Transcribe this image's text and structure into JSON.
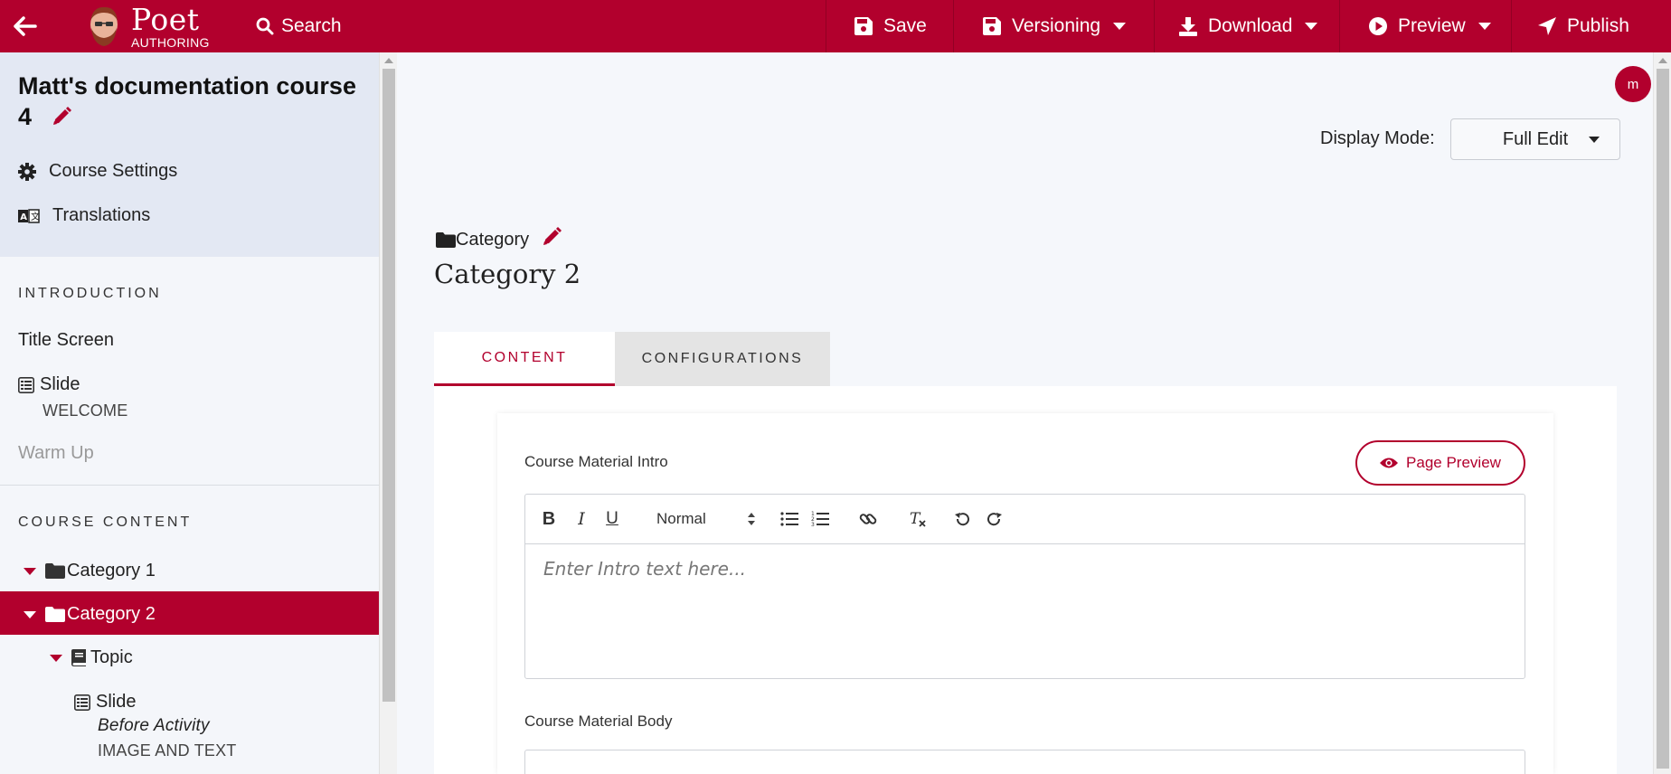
{
  "topbar": {
    "brand_name": "Poet",
    "brand_sub": "AUTHORING",
    "search_label": "Search",
    "save_label": "Save",
    "versioning_label": "Versioning",
    "download_label": "Download",
    "preview_label": "Preview",
    "publish_label": "Publish",
    "bar_color": "#b2002d"
  },
  "sidebar": {
    "course_title": "Matt's documentation course 4",
    "links": [
      {
        "label": "Course Settings",
        "icon": "gear-icon"
      },
      {
        "label": "Translations",
        "icon": "translate-icon"
      }
    ],
    "intro_section_label": "INTRODUCTION",
    "intro_items": {
      "title_screen": "Title Screen",
      "slide_label": "Slide",
      "slide_type": "WELCOME",
      "warm_up": "Warm Up"
    },
    "course_content_label": "COURSE CONTENT",
    "tree": {
      "category1": "Category 1",
      "category2": "Category 2",
      "topic": "Topic",
      "slide_label": "Slide",
      "slide_name": "Before Activity",
      "slide_type": "IMAGE AND TEXT"
    }
  },
  "main": {
    "user_initial": "m",
    "display_mode_label": "Display Mode:",
    "display_mode_value": "Full Edit",
    "breadcrumb_label": "Category",
    "heading": "Category 2",
    "tabs": [
      {
        "label": "CONTENT",
        "active": true
      },
      {
        "label": "CONFIGURATIONS",
        "active": false
      }
    ],
    "intro_field_label": "Course Material Intro",
    "page_preview_label": "Page Preview",
    "format_value": "Normal",
    "intro_placeholder": "Enter Intro text here...",
    "body_field_label": "Course Material Body"
  }
}
